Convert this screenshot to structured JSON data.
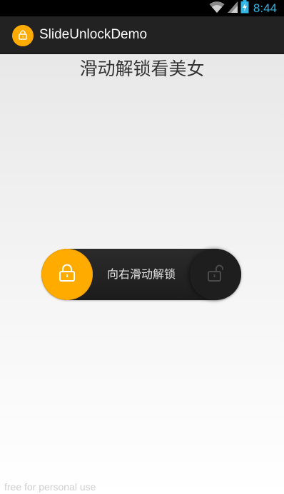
{
  "status_bar": {
    "time": "8:44",
    "icons": [
      "wifi-icon",
      "signal-icon",
      "battery-charging-icon"
    ],
    "time_color": "#33b5e5"
  },
  "action_bar": {
    "title": "SlideUnlockDemo",
    "icon": "lock-icon",
    "accent_color": "#ffab00"
  },
  "content": {
    "heading": "滑动解锁看美女"
  },
  "slider": {
    "hint": "向右滑动解锁",
    "thumb_icon": "lock-icon",
    "target_icon": "unlock-icon",
    "thumb_color": "#ffab00",
    "track_color": "#222222"
  },
  "watermark": "free for personal use"
}
